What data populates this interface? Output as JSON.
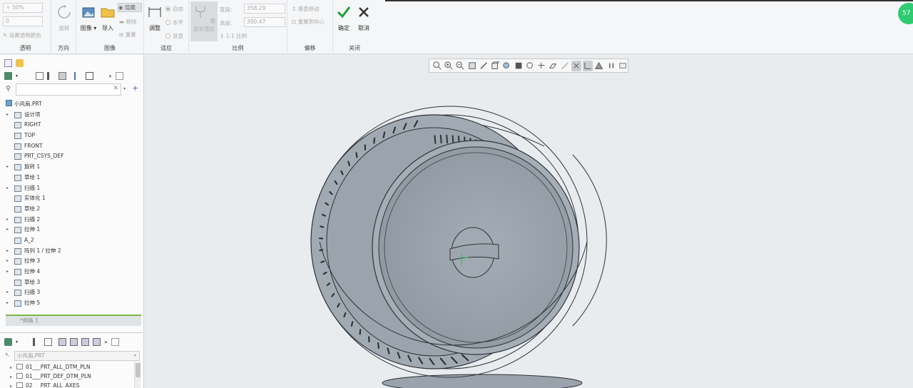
{
  "ribbon": {
    "transparency": {
      "value": "50%",
      "num": "0",
      "set_color": "设置透明颜色",
      "label": "透明"
    },
    "direction": {
      "rotate": "旋转",
      "label": "方向"
    },
    "image": {
      "image_btn": "图像",
      "import_btn": "导入",
      "hide": "隐藏",
      "remove": "移除",
      "reset": "重置",
      "label": "图像"
    },
    "fit": {
      "adjust": "调整",
      "free": "自由",
      "horizontal": "水平",
      "vertical": "竖直",
      "label": "适应"
    },
    "scale": {
      "lock_ratio": "锁定长宽比",
      "width_label": "宽度:",
      "width_value": "358.29",
      "height_label": "高度:",
      "height_value": "390.47",
      "ratio": "1:1 比例",
      "label": "比例"
    },
    "offset": {
      "vertical_move": "垂直移动",
      "reset_center": "重置到中心",
      "label": "偏移"
    },
    "close": {
      "ok": "确定",
      "cancel": "取消",
      "label": "关闭"
    },
    "badge": "57"
  },
  "tree": {
    "filter_placeholder": "",
    "root": "小风扇.PRT",
    "items": [
      {
        "label": "设计项",
        "arrow": "▸",
        "icon": "design-items-icon"
      },
      {
        "label": "RIGHT",
        "arrow": "",
        "icon": "datum-plane-icon"
      },
      {
        "label": "TOP",
        "arrow": "",
        "icon": "datum-plane-icon"
      },
      {
        "label": "FRONT",
        "arrow": "",
        "icon": "datum-plane-icon"
      },
      {
        "label": "PRT_CSYS_DEF",
        "arrow": "",
        "icon": "csys-icon"
      },
      {
        "label": "旋转 1",
        "arrow": "▸",
        "icon": "revolve-icon"
      },
      {
        "label": "草绘 1",
        "arrow": "",
        "icon": "sketch-icon"
      },
      {
        "label": "扫描 1",
        "arrow": "▸",
        "icon": "sweep-icon"
      },
      {
        "label": "实体化 1",
        "arrow": "",
        "icon": "solidify-icon"
      },
      {
        "label": "草绘 2",
        "arrow": "",
        "icon": "sketch-icon"
      },
      {
        "label": "扫描 2",
        "arrow": "▸",
        "icon": "sweep-icon"
      },
      {
        "label": "拉伸 1",
        "arrow": "▸",
        "icon": "extrude-icon"
      },
      {
        "label": "A_2",
        "arrow": "",
        "icon": "axis-icon"
      },
      {
        "label": "阵列 1 / 拉伸 2",
        "arrow": "▸",
        "icon": "pattern-icon"
      },
      {
        "label": "拉伸 3",
        "arrow": "▸",
        "icon": "extrude-icon"
      },
      {
        "label": "拉伸 4",
        "arrow": "▸",
        "icon": "extrude-icon"
      },
      {
        "label": "草绘 3",
        "arrow": "",
        "icon": "sketch-icon"
      },
      {
        "label": "扫描 3",
        "arrow": "▸",
        "icon": "sweep-icon"
      },
      {
        "label": "拉伸 5",
        "arrow": "▸",
        "icon": "extrude-icon"
      }
    ],
    "insert_here": "*倒角 1"
  },
  "layers": {
    "selector": "小风扇.PRT",
    "items": [
      "01___PRT_ALL_DTM_PLN",
      "01___PRT_DEF_DTM_PLN",
      "02___PRT_ALL_AXES"
    ]
  },
  "colors": {
    "accent_green": "#2ecc71",
    "model_fill": "#aeb6bd",
    "model_edge": "#2f3338"
  }
}
